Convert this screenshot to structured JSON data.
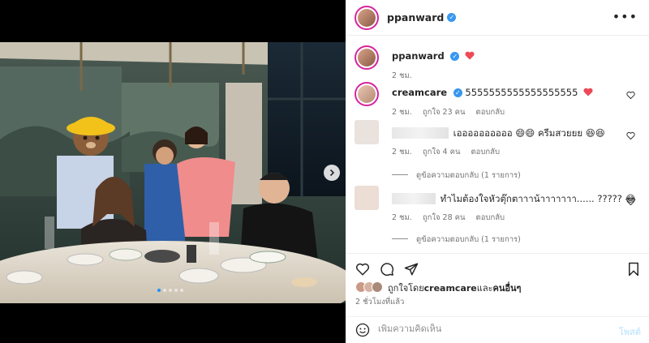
{
  "post": {
    "author": "ppanward",
    "photo_dots": 5,
    "active_dot": 1
  },
  "caption": {
    "username": "ppanward",
    "time": "2 ชม."
  },
  "comments": [
    {
      "username": "creamcare",
      "text": "5555555555555555555",
      "time": "2 ชม.",
      "likes": "ถูกใจ 23 คน",
      "reply": "ตอบกลับ"
    },
    {
      "username": "",
      "text": "เออออออออออ 😄😄 ครีมสวยยย 😆😆",
      "time": "2 ชม.",
      "likes": "ถูกใจ 4 คน",
      "reply": "ตอบกลับ",
      "view_replies": "ดูข้อความตอบกลับ (1 รายการ)"
    },
    {
      "username": "",
      "text": "ทำไมต้องใจหัวตุ๊กตาาาน้าาาาาาา...... ????? 😂",
      "time": "2 ชม.",
      "likes": "ถูกใจ 28 คน",
      "reply": "ตอบกลับ",
      "view_replies": "ดูข้อความตอบกลับ (1 รายการ)"
    }
  ],
  "likes_line": {
    "prefix": "ถูกใจโดย ",
    "user": "creamcare",
    "middle": " และ",
    "others": "คนอื่นๆ"
  },
  "time_ago": "2 ชั่วโมงที่แล้ว",
  "comment_box": {
    "placeholder": "เพิ่มความคิดเห็น",
    "post_label": "โพสต์"
  },
  "icons": [
    "more-icon",
    "verified-icon",
    "heart-icon",
    "comment-icon",
    "share-icon",
    "save-icon",
    "emoji-icon",
    "next-arrow-icon"
  ],
  "colors": {
    "accent": "#3897f0",
    "heart": "#ed4956",
    "story_ring": "#d6249f",
    "post_disabled": "#b2dffc"
  }
}
